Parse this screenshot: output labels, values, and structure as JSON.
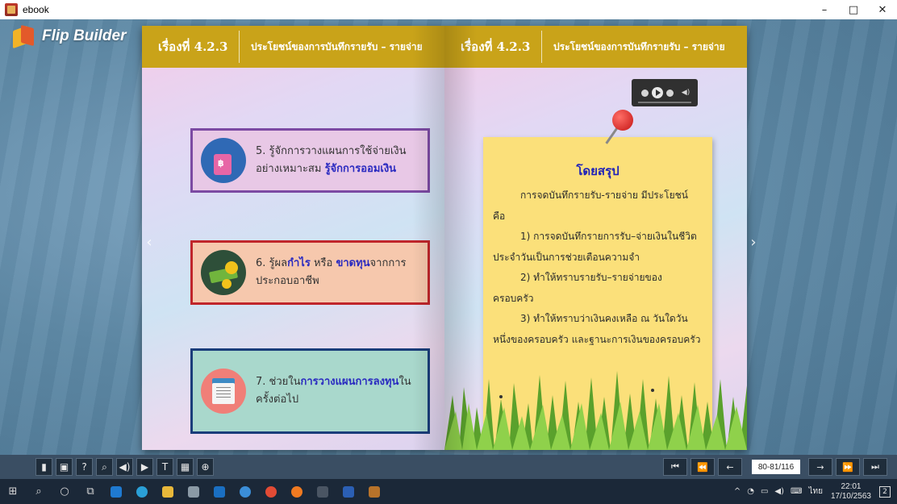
{
  "window": {
    "title": "ebook",
    "minimize": "–",
    "maximize": "□",
    "close": "✕"
  },
  "logo": {
    "text": "Flip Builder"
  },
  "left_page": {
    "header_topic": "เรื่องที่ 4.2.3",
    "header_title": "ประโยชน์ของการบันทึกรายรับ – รายจ่าย",
    "cards": [
      {
        "icon": "piggy-bank-icon",
        "prefix": "5. รู้จักการวางแผนการใช้จ่ายเงินอย่างเหมาะสม ",
        "emphasis": "รู้จักการออมเงิน",
        "suffix": ""
      },
      {
        "icon": "money-coins-icon",
        "prefix": "6. รู้ผล",
        "emphasis": "กำไร",
        "middle": " หรือ ",
        "emphasis2": "ขาดทุน",
        "suffix": "จากการประกอบอาชีพ"
      },
      {
        "icon": "document-plan-icon",
        "prefix": "7. ช่วยใน",
        "emphasis": "การวางแผนการลงทุน",
        "suffix": "ในครั้งต่อไป"
      }
    ]
  },
  "right_page": {
    "header_topic": "เรื่องที่ 4.2.3",
    "header_title": "ประโยชน์ของการบันทึกรายรับ – รายจ่าย",
    "note_title": "โดยสรุป",
    "note_lines": [
      "การจดบันทึกรายรับ-รายจ่าย มีประโยชน์ คือ",
      "1) การจดบันทึกรายการรับ–จ่ายเงินในชีวิตประจำวันเป็นการช่วยเตือนความจำ",
      "2) ทำให้ทราบรายรับ–รายจ่ายของครอบครัว",
      "3) ทำให้ทราบว่าเงินคงเหลือ ณ วันใดวันหนึ่งของครอบครัว และฐานะการเงินของครอบครัว"
    ]
  },
  "toolbar": {
    "left_buttons": [
      "bookmark-icon",
      "thumbnail-icon",
      "help-icon",
      "search-icon",
      "sound-icon",
      "slideshow-icon",
      "text-icon",
      "grid-icon",
      "zoom-icon"
    ],
    "left_glyphs": [
      "▮",
      "▣",
      "?",
      "⌕",
      "◀)",
      "▶",
      "T",
      "▦",
      "⊕"
    ],
    "page_indicator": "80-81/116"
  },
  "taskbar": {
    "language": "ไทย",
    "time": "22:01",
    "date": "17/10/2563",
    "notifications": "2"
  }
}
